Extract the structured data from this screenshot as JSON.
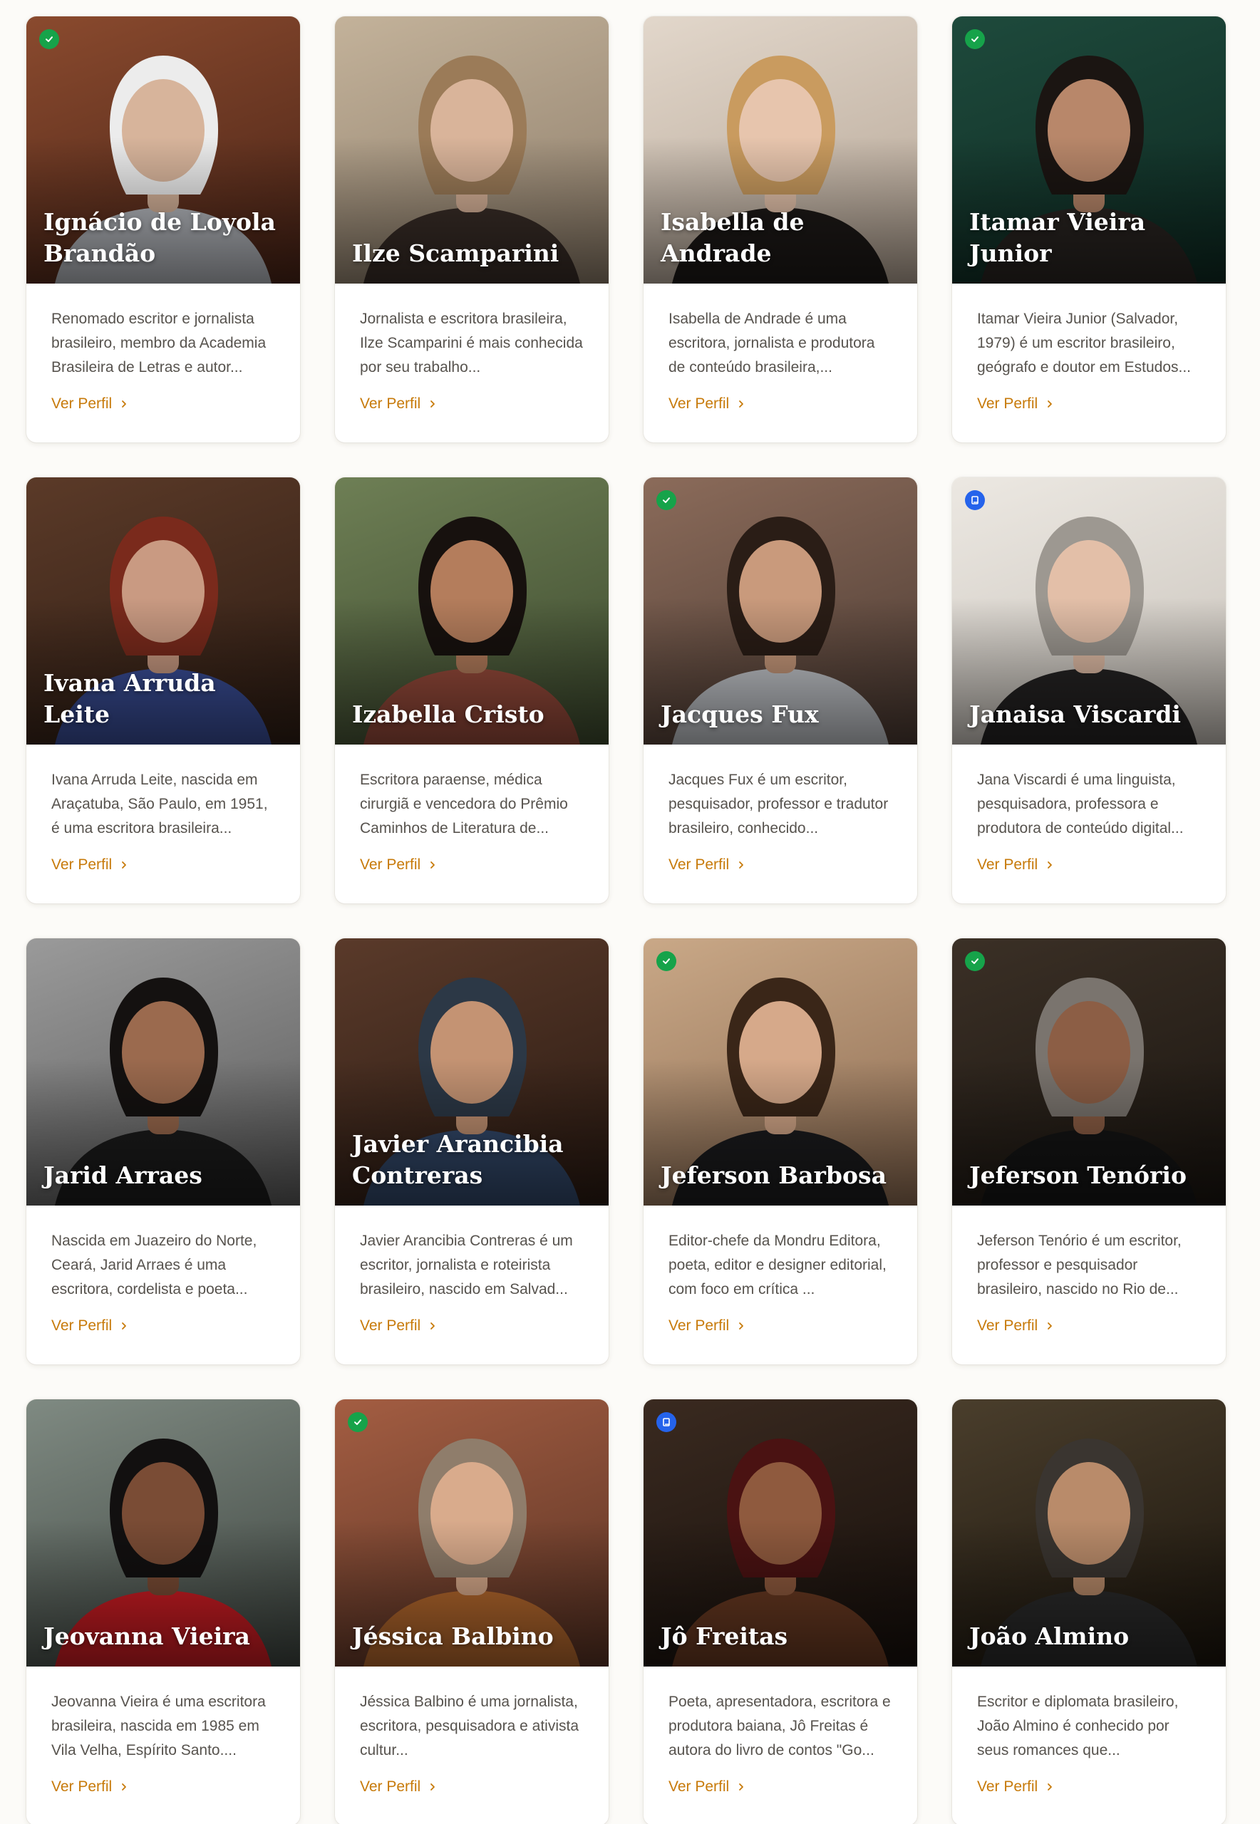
{
  "link_label": "Ver Perfil",
  "authors": [
    {
      "name": "Ignácio de Loyola Brandão",
      "desc": "Renomado escritor e jornalista brasileiro, membro da Academia Brasileira de Letras e autor...",
      "badge": "verified",
      "bg": [
        "#8a4a2e",
        "#4a2417"
      ],
      "skin": "#d7b49b",
      "hair": "#ececec",
      "shirt": "#b9bcc2"
    },
    {
      "name": "Ilze Scamparini",
      "desc": "Jornalista e escritora brasileira, Ilze Scamparini é mais conhecida por seu trabalho...",
      "badge": "",
      "bg": [
        "#c3b29a",
        "#8d7d6a"
      ],
      "skin": "#d9b49a",
      "hair": "#9b7b58",
      "shirt": "#3a2e28"
    },
    {
      "name": "Isabella de Andrade",
      "desc": "Isabella de Andrade é uma escritora, jornalista e produtora de conteúdo brasileira,...",
      "badge": "",
      "bg": [
        "#e2d7cb",
        "#b5a595"
      ],
      "skin": "#e7c5ad",
      "hair": "#c99b5f",
      "shirt": "#1e1a18"
    },
    {
      "name": "Itamar Vieira Junior",
      "desc": "Itamar Vieira Junior (Salvador, 1979) é um escritor brasileiro, geógrafo e doutor em Estudos...",
      "badge": "verified",
      "bg": [
        "#1e4a3c",
        "#0e2a22"
      ],
      "skin": "#b8876a",
      "hair": "#1b1512",
      "shirt": "#2a2522"
    },
    {
      "name": "Ivana Arruda Leite",
      "desc": "Ivana Arruda Leite, nascida em Araçatuba, São Paulo, em 1951, é uma escritora brasileira...",
      "badge": "",
      "bg": [
        "#5b3a28",
        "#2e1d14"
      ],
      "skin": "#c99a82",
      "hair": "#7a2a1c",
      "shirt": "#3b4f9a"
    },
    {
      "name": "Izabella Cristo",
      "desc": "Escritora paraense, médica cirurgiã e vencedora do Prêmio Caminhos de Literatura de...",
      "badge": "",
      "bg": [
        "#6e7f55",
        "#3d4a2e"
      ],
      "skin": "#b47d5c",
      "hair": "#17110e",
      "shirt": "#9a4c3c"
    },
    {
      "name": "Jacques Fux",
      "desc": "Jacques Fux é um escritor, pesquisador, professor e tradutor brasileiro, conhecido...",
      "badge": "verified",
      "bg": [
        "#8b6b5a",
        "#4c3b33"
      ],
      "skin": "#c99a7c",
      "hair": "#2a1d16",
      "shirt": "#c8cbd0"
    },
    {
      "name": "Janaisa Viscardi",
      "desc": "Jana Viscardi é uma linguista, pesquisadora, professora e produtora de conteúdo digital...",
      "badge": "book",
      "bg": [
        "#ece8e2",
        "#c8c2ba"
      ],
      "skin": "#e3bfa8",
      "hair": "#9d9891",
      "shirt": "#262424"
    },
    {
      "name": "Jarid Arraes",
      "desc": "Nascida em Juazeiro do Norte, Ceará, Jarid Arraes é uma escritora, cordelista e poeta...",
      "badge": "",
      "bg": [
        "#9a9a9a",
        "#5b5b5b"
      ],
      "skin": "#9b6a4e",
      "hair": "#141110",
      "shirt": "#1c1c1c"
    },
    {
      "name": "Javier Arancibia Contreras",
      "desc": "Javier Arancibia Contreras é um escritor, jornalista e roteirista brasileiro, nascido em Salvad...",
      "badge": "",
      "bg": [
        "#5a3a2a",
        "#2a1a12"
      ],
      "skin": "#c49373",
      "hair": "#2c3846",
      "shirt": "#33496b"
    },
    {
      "name": "Jeferson Barbosa",
      "desc": "Editor-chefe da Mondru Editora, poeta, editor e designer editorial, com foco em crítica ...",
      "badge": "verified",
      "bg": [
        "#c9a887",
        "#8d6c52"
      ],
      "skin": "#d6a98a",
      "hair": "#3a2618",
      "shirt": "#1c1c1e"
    },
    {
      "name": "Jeferson Tenório",
      "desc": "Jeferson Tenório é um escritor, professor e pesquisador brasileiro, nascido no Rio de...",
      "badge": "verified",
      "bg": [
        "#3b3026",
        "#1a1510"
      ],
      "skin": "#8c5e45",
      "hair": "#7a746e",
      "shirt": "#151515"
    },
    {
      "name": "Jeovanna Vieira",
      "desc": "Jeovanna Vieira é uma escritora brasileira, nascida em 1985 em Vila Velha, Espírito Santo....",
      "badge": "",
      "bg": [
        "#7f8a82",
        "#3e4540"
      ],
      "skin": "#7a4c35",
      "hair": "#121010",
      "shirt": "#d11d24"
    },
    {
      "name": "Jéssica Balbino",
      "desc": "Jéssica Balbino é uma jornalista, escritora, pesquisadora e ativista cultur...",
      "badge": "verified",
      "bg": [
        "#a35d42",
        "#5a3324"
      ],
      "skin": "#d9ab8c",
      "hair": "#8f7d6b",
      "shirt": "#b86a2e"
    },
    {
      "name": "Jô Freitas",
      "desc": "Poeta, apresentadora, escritora e produtora baiana, Jô Freitas é autora do livro de contos \"Go...",
      "badge": "book",
      "bg": [
        "#3a2a20",
        "#160f0b"
      ],
      "skin": "#8f5a3e",
      "hair": "#4a1212",
      "shirt": "#6a3a22"
    },
    {
      "name": "João Almino",
      "desc": "Escritor e diplomata brasileiro, João Almino é conhecido por seus romances que...",
      "badge": "",
      "bg": [
        "#4a3e2c",
        "#1a140c"
      ],
      "skin": "#b98b6a",
      "hair": "#3a3530",
      "shirt": "#2b2b2b"
    }
  ]
}
